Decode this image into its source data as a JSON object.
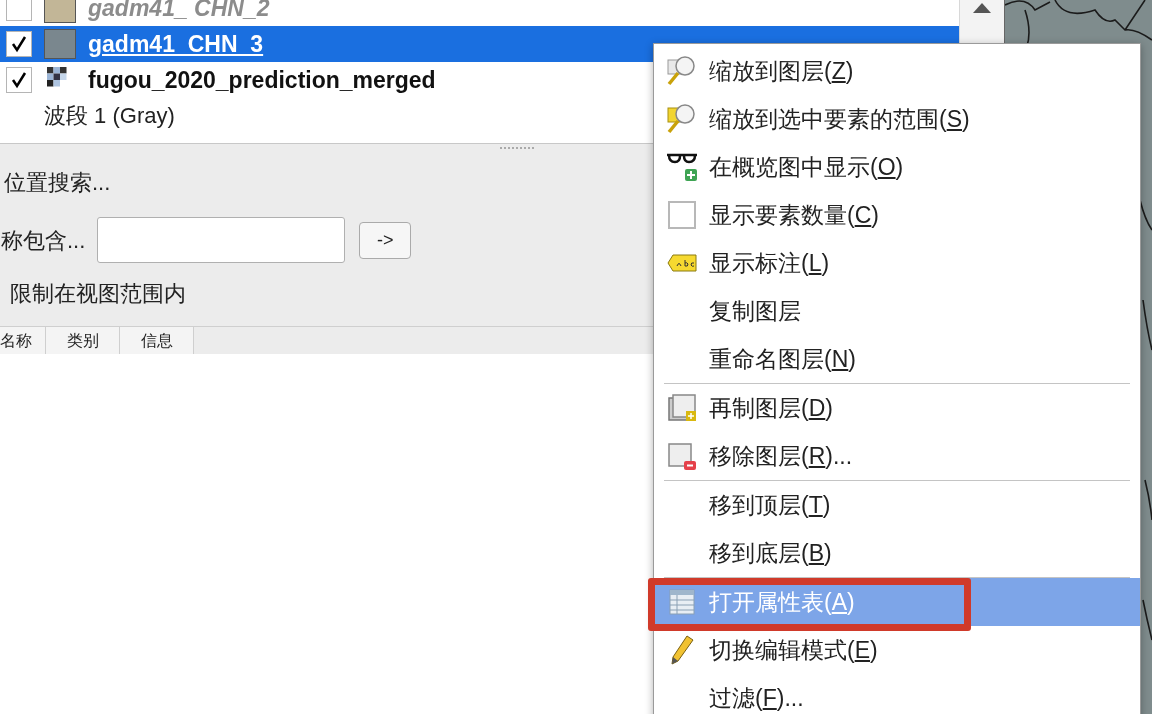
{
  "layers": [
    {
      "name": "gadm41_ CHN_2",
      "checked": false,
      "selected": false,
      "greyed": true,
      "kind": "vector",
      "color": "#c2b697"
    },
    {
      "name": "gadm41_CHN_3",
      "checked": true,
      "selected": true,
      "greyed": false,
      "kind": "vector",
      "color": "#7a878e"
    },
    {
      "name": "fugou_2020_prediction_merged",
      "checked": true,
      "selected": false,
      "greyed": false,
      "kind": "raster",
      "legend": "波段 1 (Gray)"
    }
  ],
  "search_panel": {
    "title": "位置搜索...",
    "name_label": "称包含...",
    "go_button": "->",
    "restrict_label": "限制在视图范围内",
    "columns": [
      "名称",
      "类别",
      "信息"
    ]
  },
  "context_menu": [
    {
      "kind": "zoom",
      "text": "缩放到图层(",
      "key": "Z",
      "tail": ")",
      "selected": false
    },
    {
      "kind": "zoom-selected",
      "text": "缩放到选中要素的范围(",
      "key": "S",
      "tail": ")",
      "selected": false
    },
    {
      "kind": "overview",
      "text": "在概览图中显示(",
      "key": "O",
      "tail": ")",
      "selected": false
    },
    {
      "kind": "checkbox",
      "checked": false,
      "text": "显示要素数量(",
      "key": "C",
      "tail": ")",
      "selected": false
    },
    {
      "kind": "label",
      "text": "显示标注(",
      "key": "L",
      "tail": ")",
      "selected": false
    },
    {
      "kind": "plain",
      "text": "复制图层",
      "selected": false
    },
    {
      "kind": "plain",
      "text": "重命名图层(",
      "key": "N",
      "tail": ")",
      "selected": false
    },
    {
      "kind": "separator"
    },
    {
      "kind": "duplicate",
      "text": "再制图层(",
      "key": "D",
      "tail": ")",
      "selected": false
    },
    {
      "kind": "remove",
      "text": "移除图层(",
      "key": "R",
      "tail": ")...",
      "selected": false
    },
    {
      "kind": "separator"
    },
    {
      "kind": "plain",
      "text": "移到顶层(",
      "key": "T",
      "tail": ")",
      "selected": false
    },
    {
      "kind": "plain",
      "text": "移到底层(",
      "key": "B",
      "tail": ")",
      "selected": false
    },
    {
      "kind": "separator"
    },
    {
      "kind": "table",
      "text": "打开属性表(",
      "key": "A",
      "tail": ")",
      "selected": true
    },
    {
      "kind": "pencil",
      "text": "切换编辑模式(",
      "key": "E",
      "tail": ")",
      "selected": false
    },
    {
      "kind": "plain",
      "text": "过滤(",
      "key": "F",
      "tail": ")...",
      "selected": false
    }
  ]
}
